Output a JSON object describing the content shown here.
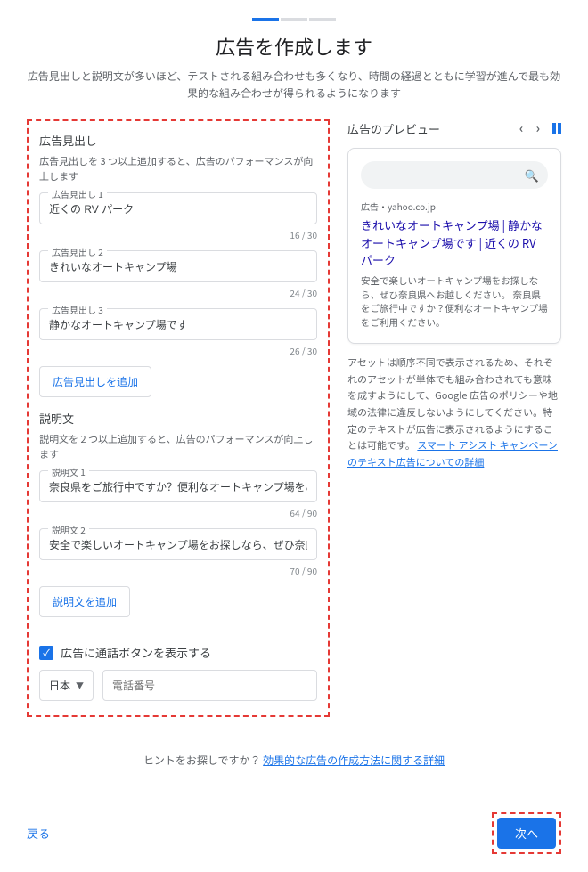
{
  "title": "広告を作成します",
  "subtitle": "広告見出しと説明文が多いほど、テストされる組み合わせも多くなり、時間の経過とともに学習が進んで最も効果的な組み合わせが得られるようになります",
  "headline_section": {
    "title": "広告見出し",
    "help": "広告見出しを 3 つ以上追加すると、広告のパフォーマンスが向上します",
    "fields": [
      {
        "label": "広告見出し 1",
        "value": "近くの RV パーク",
        "count": "16 / 30"
      },
      {
        "label": "広告見出し 2",
        "value": "きれいなオートキャンプ場",
        "count": "24 / 30"
      },
      {
        "label": "広告見出し 3",
        "value": "静かなオートキャンプ場です",
        "count": "26 / 30"
      }
    ],
    "add_btn": "広告見出しを追加"
  },
  "description_section": {
    "title": "説明文",
    "help": "説明文を 2 つ以上追加すると、広告のパフォーマンスが向上します",
    "fields": [
      {
        "label": "説明文 1",
        "value": "奈良県をご旅行中ですか？便利なオートキャンプ場をご利用",
        "count": "64 / 90"
      },
      {
        "label": "説明文 2",
        "value": "安全で楽しいオートキャンプ場をお探しなら、ぜひ奈良県へ",
        "count": "70 / 90"
      }
    ],
    "add_btn": "説明文を追加"
  },
  "phone": {
    "checkbox_label": "広告に通話ボタンを表示する",
    "country": "日本",
    "placeholder": "電話番号"
  },
  "preview": {
    "title": "広告のプレビュー",
    "ad_label": "広告・yahoo.co.jp",
    "headline": "きれいなオートキャンプ場 | 静かなオートキャンプ場です | 近くの RV パーク",
    "desc": "安全で楽しいオートキャンプ場をお探しなら、ぜひ奈良県へお越しください。 奈良県をご旅行中ですか？便利なオートキャンプ場をご利用ください。",
    "note_text": "アセットは順序不同で表示されるため、それぞれのアセットが単体でも組み合わされても意味を成すようにして、Google 広告のポリシーや地域の法律に違反しないようにしてください。特定のテキストが広告に表示されるようにすることは可能です。",
    "note_link": "スマート アシスト キャンペーンのテキスト広告についての詳細"
  },
  "hint": {
    "prefix": "ヒントをお探しですか？",
    "link": "効果的な広告の作成方法に関する詳細"
  },
  "footer": {
    "back": "戻る",
    "next": "次へ"
  }
}
